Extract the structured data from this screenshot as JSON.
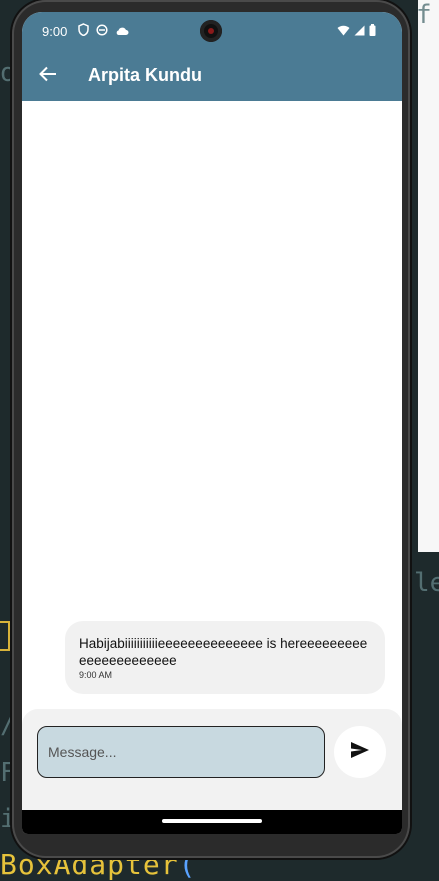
{
  "status_bar": {
    "time": "9:00",
    "left_icons": [
      "shield-icon",
      "data-saver-icon",
      "cloud-icon"
    ],
    "right_icons": [
      "wifi-icon",
      "signal-icon",
      "battery-icon"
    ]
  },
  "app_bar": {
    "title": "Arpita Kundu",
    "back_icon": "arrow-back-icon"
  },
  "messages": [
    {
      "text": "Habijabiiiiiiiiiiieeeeeeeeeeeeee is hereeeeeeeeeeeeeeeeeeeeee",
      "time": "9:00 AM"
    }
  ],
  "composer": {
    "placeholder": "Message...",
    "value": "",
    "send_icon": "send-icon"
  },
  "colors": {
    "app_bar": "#4b7b94",
    "input_fill": "#c8d9e0",
    "bubble": "#f1f1f1"
  }
}
